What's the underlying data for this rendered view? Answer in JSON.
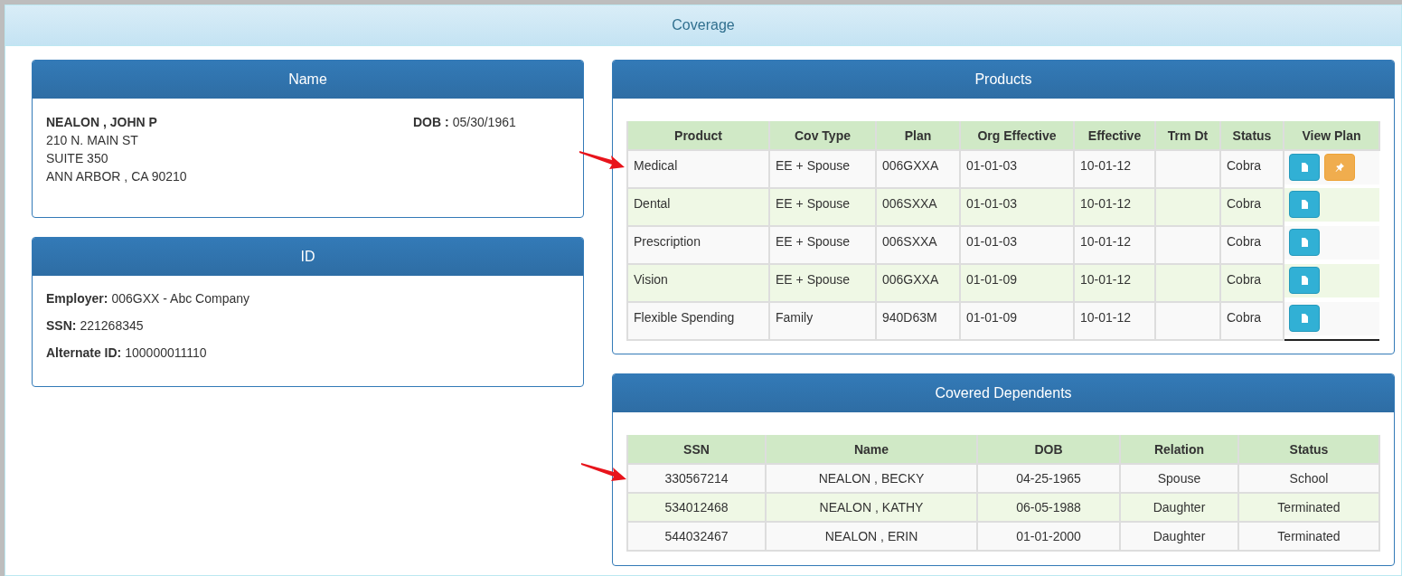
{
  "page": {
    "title": "Coverage"
  },
  "name_panel": {
    "title": "Name",
    "name": "NEALON , JOHN P",
    "address": [
      "210 N. MAIN ST",
      "SUITE 350",
      "ANN ARBOR , CA 90210"
    ],
    "dob_label": "DOB :",
    "dob": "05/30/1961"
  },
  "id_panel": {
    "title": "ID",
    "fields": [
      {
        "label": "Employer:",
        "value": "006GXX - Abc Company"
      },
      {
        "label": "SSN:",
        "value": "221268345"
      },
      {
        "label": "Alternate ID:",
        "value": "100000011110"
      }
    ]
  },
  "products": {
    "title": "Products",
    "columns": [
      "Product",
      "Cov Type",
      "Plan",
      "Org Effective",
      "Effective",
      "Trm Dt",
      "Status",
      "View Plan"
    ],
    "rows": [
      {
        "cells": [
          "Medical",
          "EE + Spouse",
          "006GXXA",
          "01-01-03",
          "10-01-12",
          "",
          "Cobra"
        ],
        "buttons": [
          {
            "kind": "document"
          },
          {
            "kind": "pin"
          }
        ]
      },
      {
        "cells": [
          "Dental",
          "EE + Spouse",
          "006SXXA",
          "01-01-03",
          "10-01-12",
          "",
          "Cobra"
        ],
        "buttons": [
          {
            "kind": "document"
          }
        ]
      },
      {
        "cells": [
          "Prescription",
          "EE + Spouse",
          "006SXXA",
          "01-01-03",
          "10-01-12",
          "",
          "Cobra"
        ],
        "buttons": [
          {
            "kind": "document"
          }
        ]
      },
      {
        "cells": [
          "Vision",
          "EE + Spouse",
          "006GXXA",
          "01-01-09",
          "10-01-12",
          "",
          "Cobra"
        ],
        "buttons": [
          {
            "kind": "document"
          }
        ]
      },
      {
        "cells": [
          "Flexible Spending",
          "Family",
          "940D63M",
          "01-01-09",
          "10-01-12",
          "",
          "Cobra"
        ],
        "buttons": [
          {
            "kind": "document"
          }
        ]
      }
    ]
  },
  "dependents": {
    "title": "Covered Dependents",
    "columns": [
      "SSN",
      "Name",
      "DOB",
      "Relation",
      "Status"
    ],
    "rows": [
      [
        "330567214",
        "NEALON , BECKY",
        "04-25-1965",
        "Spouse",
        "School"
      ],
      [
        "534012468",
        "NEALON , KATHY",
        "06-05-1988",
        "Daughter",
        "Terminated"
      ],
      [
        "544032467",
        "NEALON , ERIN",
        "01-01-2000",
        "Daughter",
        "Terminated"
      ]
    ]
  }
}
